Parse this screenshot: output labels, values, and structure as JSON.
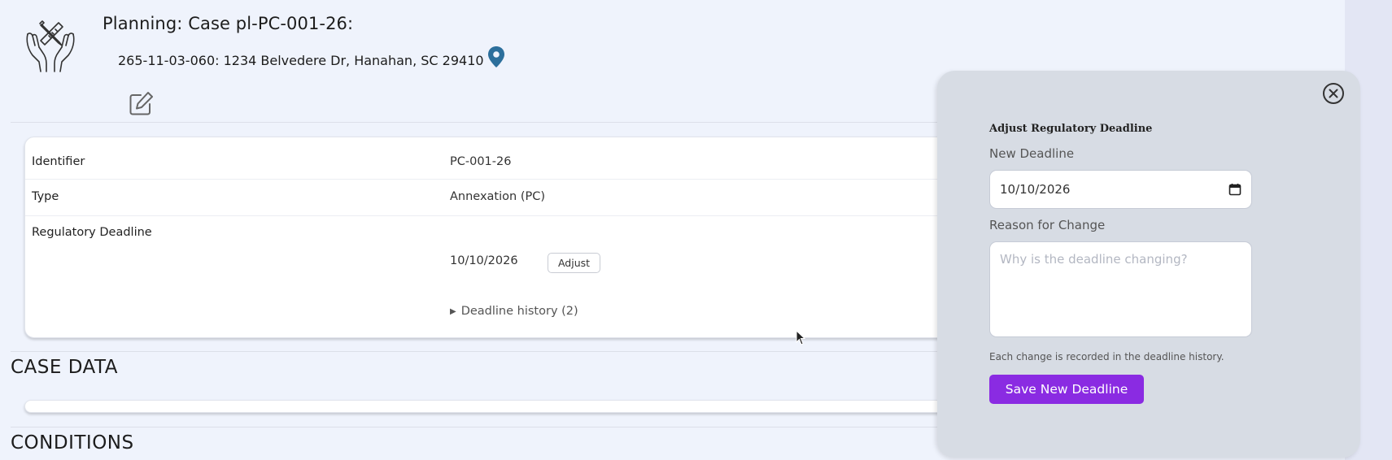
{
  "header": {
    "case_title": "Planning: Case pl-PC-001-26:",
    "address": "265-11-03-060: 1234 Belvedere Dr, Hanahan, SC 29410"
  },
  "details": {
    "rows": [
      {
        "label": "Identifier",
        "value": "PC-001-26"
      },
      {
        "label": "Type",
        "value": "Annexation (PC)"
      },
      {
        "label": "Regulatory Deadline",
        "value": "10/10/2026"
      }
    ],
    "adjust_label": "Adjust",
    "history_label": "Deadline history (2)"
  },
  "sections": {
    "case_data": "CASE DATA",
    "conditions": "CONDITIONS"
  },
  "panel": {
    "heading": "Adjust Regulatory Deadline",
    "new_deadline_label": "New Deadline",
    "new_deadline_value": "10/10/2026",
    "reason_label": "Reason for Change",
    "reason_placeholder": "Why is the deadline changing?",
    "hint": "Each change is recorded in the deadline history.",
    "save_label": "Save New Deadline"
  },
  "colors": {
    "accent": "#8a2be2",
    "pin": "#2c6f9c",
    "background": "#eff3fc",
    "panel": "#d7dce4"
  },
  "icons": [
    "hands-tools-logo-icon",
    "location-pin-icon",
    "edit-icon",
    "close-circle-icon",
    "calendar-icon",
    "triangle-right-icon",
    "mouse-cursor-icon"
  ]
}
